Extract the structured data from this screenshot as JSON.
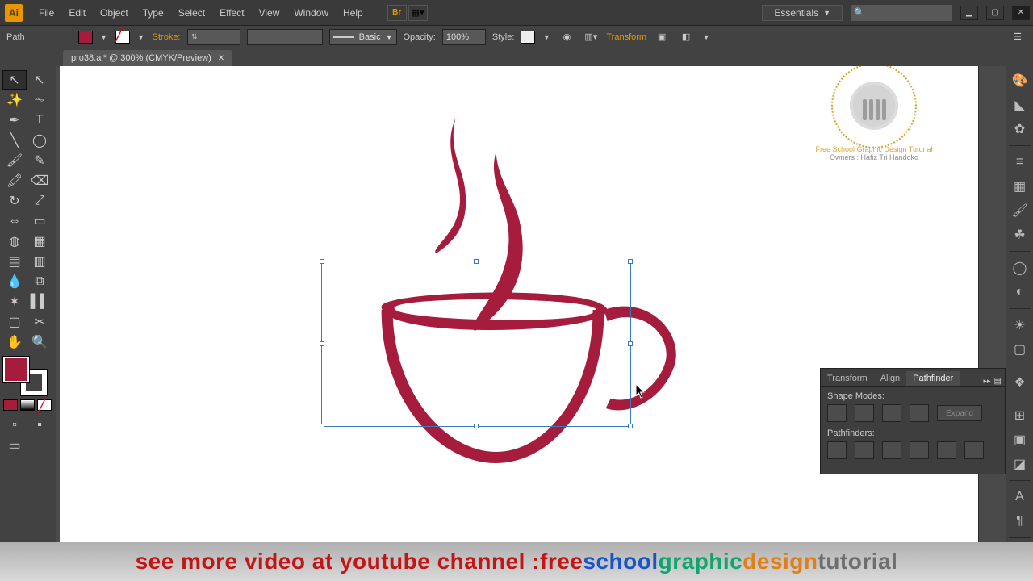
{
  "app": {
    "logo": "Ai"
  },
  "menu": {
    "items": [
      "File",
      "Edit",
      "Object",
      "Type",
      "Select",
      "Effect",
      "View",
      "Window",
      "Help"
    ]
  },
  "workspace": {
    "name": "Essentials"
  },
  "options": {
    "selection_label": "Path",
    "stroke_label": "Stroke:",
    "brush_profile": "Basic",
    "opacity_label": "Opacity:",
    "opacity_value": "100%",
    "style_label": "Style:",
    "transform_link": "Transform"
  },
  "tab": {
    "title": "pro38.ai* @ 300% (CMYK/Preview)"
  },
  "pathfinder": {
    "tabs": [
      "Transform",
      "Align",
      "Pathfinder"
    ],
    "shape_modes_label": "Shape Modes:",
    "pathfinders_label": "Pathfinders:",
    "expand_label": "Expand"
  },
  "watermark": {
    "line1": "Free School Graphic Design Tutorial",
    "line2": "Owners : Hafiz Tri Handoko"
  },
  "caption": {
    "p1": "see more video at youtube channel :",
    "p2": " free ",
    "p3": "school ",
    "p4": "graphic ",
    "p5": "design ",
    "p6": "tutorial"
  },
  "colors": {
    "brand": "#a51c3d",
    "selection": "#3a7abf"
  }
}
